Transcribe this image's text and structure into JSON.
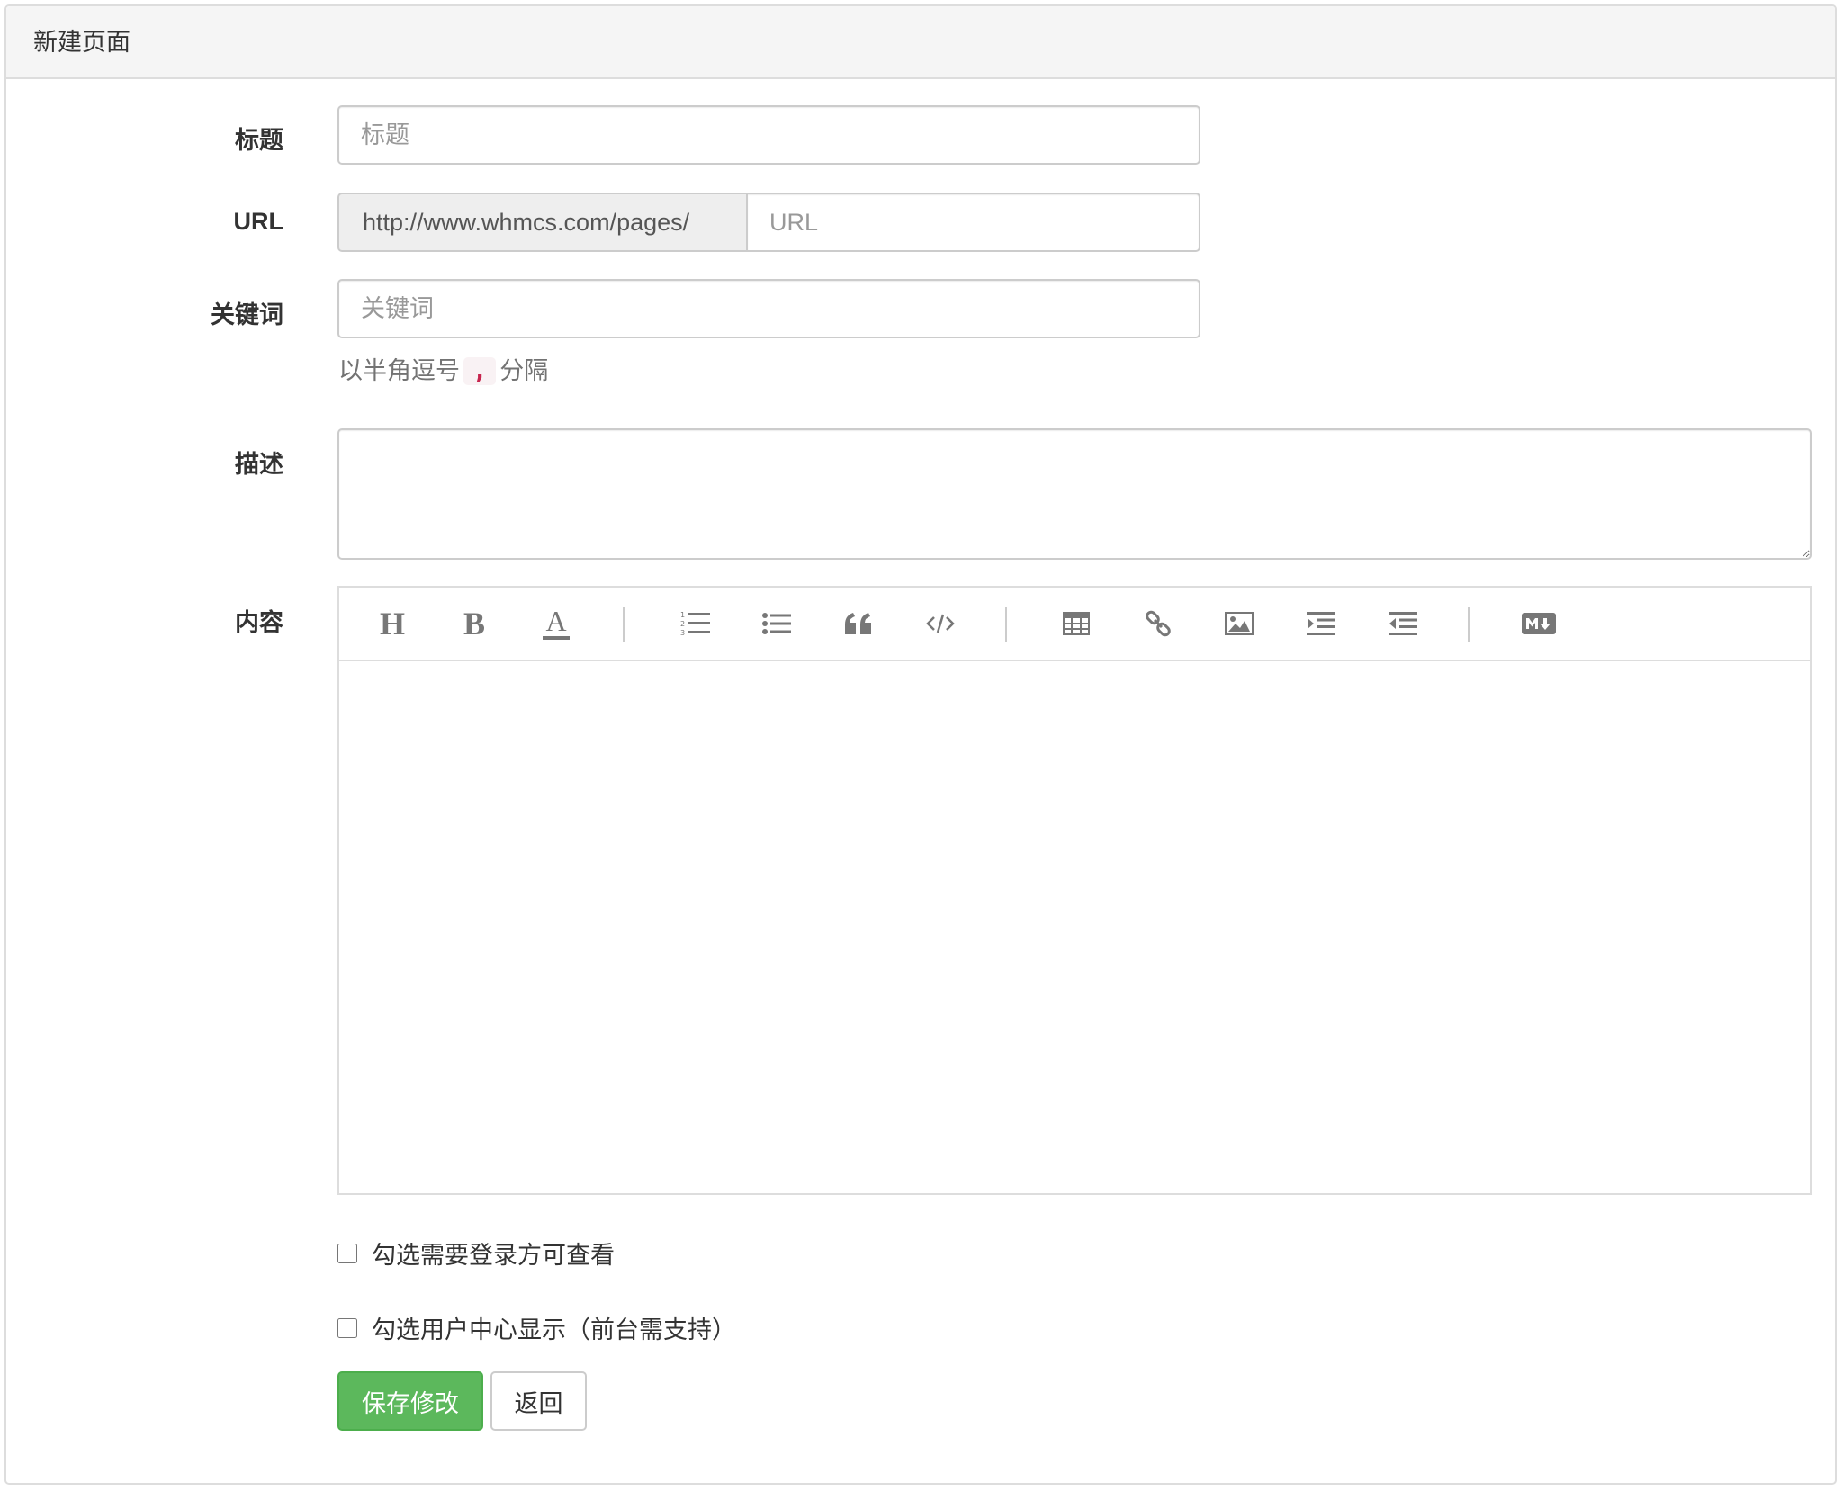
{
  "panel": {
    "title": "新建页面"
  },
  "fields": {
    "title": {
      "label": "标题",
      "placeholder": "标题",
      "value": ""
    },
    "url": {
      "label": "URL",
      "prefix": "http://www.whmcs.com/pages/",
      "placeholder": "URL",
      "value": ""
    },
    "keywords": {
      "label": "关键词",
      "placeholder": "关键词",
      "value": "",
      "help_before": "以半角逗号",
      "help_code": ",",
      "help_after": "分隔"
    },
    "description": {
      "label": "描述",
      "value": ""
    },
    "content": {
      "label": "内容",
      "toolbar": [
        {
          "icon": "heading-icon",
          "glyph": "H"
        },
        {
          "icon": "bold-icon",
          "glyph": "B"
        },
        {
          "icon": "text-color-icon",
          "glyph": "A"
        },
        {
          "icon": "ordered-list-icon"
        },
        {
          "icon": "unordered-list-icon"
        },
        {
          "icon": "blockquote-icon"
        },
        {
          "icon": "code-icon"
        },
        {
          "icon": "table-icon"
        },
        {
          "icon": "link-icon"
        },
        {
          "icon": "image-icon"
        },
        {
          "icon": "indent-icon"
        },
        {
          "icon": "outdent-icon"
        },
        {
          "icon": "markdown-icon"
        }
      ]
    }
  },
  "options": {
    "require_login": {
      "label": "勾选需要登录方可查看",
      "checked": false
    },
    "show_in_client": {
      "label": "勾选用户中心显示（前台需支持）",
      "checked": false
    }
  },
  "actions": {
    "save_label": "保存修改",
    "back_label": "返回"
  },
  "colors": {
    "primary": "#5cb85c",
    "code": "#c7254e"
  }
}
